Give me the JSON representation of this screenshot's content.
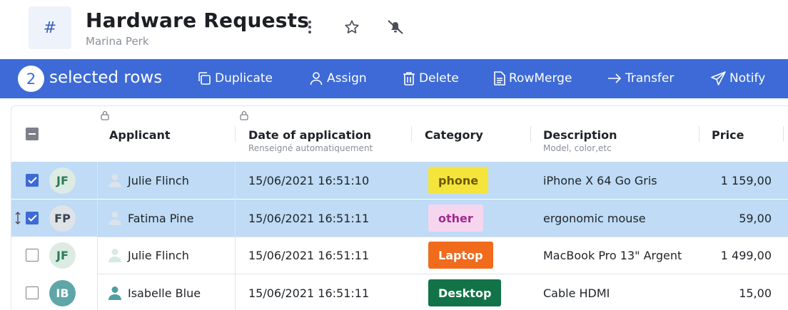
{
  "header": {
    "app_icon": "#",
    "title": "Hardware Requests",
    "owner": "Marina Perk",
    "icons": [
      "more-vertical-icon",
      "star-icon",
      "bell-off-icon"
    ]
  },
  "toolbar": {
    "selected_count": "2",
    "selected_label": "selected rows",
    "actions": [
      {
        "label": "Duplicate",
        "icon": "duplicate-icon"
      },
      {
        "label": "Assign",
        "icon": "user-icon"
      },
      {
        "label": "Delete",
        "icon": "trash-icon"
      },
      {
        "label": "RowMerge",
        "icon": "document-icon"
      },
      {
        "label": "Transfer",
        "icon": "arrow-right-icon"
      },
      {
        "label": "Notify",
        "icon": "paper-plane-icon"
      }
    ]
  },
  "columns": [
    {
      "label": "Applicant",
      "sub": "",
      "locked": true
    },
    {
      "label": "Date of application",
      "sub": "Renseigné automatiquement",
      "locked": true
    },
    {
      "label": "Category",
      "sub": "",
      "locked": false
    },
    {
      "label": "Description",
      "sub": "Model, color,etc",
      "locked": false
    },
    {
      "label": "Price",
      "sub": "",
      "locked": false
    }
  ],
  "rows": [
    {
      "checked": true,
      "initials": "JF",
      "applicant": "Julie Flinch",
      "date": "15/06/2021 16:51:10",
      "category": "phone",
      "description": "iPhone X 64 Go Gris",
      "price": "1 159,00"
    },
    {
      "checked": true,
      "initials": "FP",
      "applicant": "Fatima Pine",
      "date": "15/06/2021 16:51:11",
      "category": "other",
      "description": "ergonomic mouse",
      "price": "59,00"
    },
    {
      "checked": false,
      "initials": "JF",
      "applicant": "Julie Flinch",
      "date": "15/06/2021 16:51:11",
      "category": "Laptop",
      "description": "MacBook Pro 13\" Argent",
      "price": "1 499,00"
    },
    {
      "checked": false,
      "initials": "IB",
      "applicant": "Isabelle Blue",
      "date": "15/06/2021 16:51:11",
      "category": "Desktop",
      "description": "Cable HDMI",
      "price": "15,00"
    }
  ],
  "colors": {
    "toolbar_bg": "#3d6ad6",
    "selected_row_bg": "#bfdbf5",
    "tag_phone_bg": "#f5e43c",
    "tag_other_bg": "#f6d6ef",
    "tag_laptop_bg": "#f06b1c",
    "tag_desktop_bg": "#117347",
    "avatar_jf_bg": "#dcebe4",
    "avatar_fp_bg": "#dee3e8",
    "avatar_ib_bg": "#5fa6a8"
  }
}
